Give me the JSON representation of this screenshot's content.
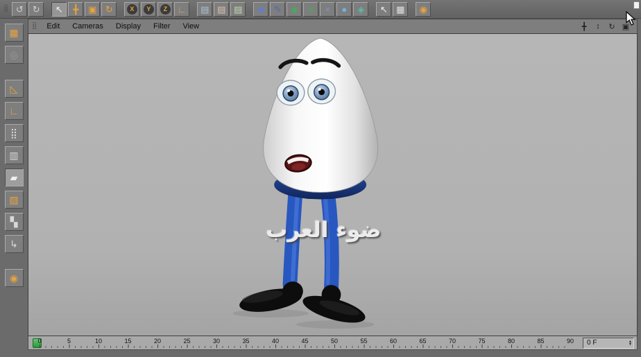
{
  "window": {
    "background": "#6b6b6b",
    "accent": "#e8a33d"
  },
  "top_toolbar": {
    "drag_handle_glyph": "⣿",
    "items": [
      {
        "name": "undo-icon",
        "glyph": "↺",
        "color": "#cfcfcf"
      },
      {
        "name": "redo-icon",
        "glyph": "↻",
        "color": "#cfcfcf"
      },
      {
        "type": "sep"
      },
      {
        "name": "live-selection-tool-icon",
        "glyph": "↖",
        "color": "#f2f2f2",
        "pressed": true
      },
      {
        "name": "move-tool-icon",
        "glyph": "╋",
        "color": "#e8a33d"
      },
      {
        "name": "scale-tool-icon",
        "glyph": "▣",
        "color": "#e8a33d"
      },
      {
        "name": "rotate-tool-icon",
        "glyph": "↻",
        "color": "#e8a33d"
      },
      {
        "type": "sep"
      },
      {
        "name": "lock-x-axis-icon",
        "glyph": "X",
        "cls": "axis"
      },
      {
        "name": "lock-y-axis-icon",
        "glyph": "Y",
        "cls": "axis"
      },
      {
        "name": "lock-z-axis-icon",
        "glyph": "Z",
        "cls": "axis"
      },
      {
        "name": "coordinate-system-icon",
        "glyph": "∟",
        "color": "#e8a33d"
      },
      {
        "type": "sep"
      },
      {
        "name": "render-view-icon",
        "glyph": "▤",
        "color": "#aebfd8"
      },
      {
        "name": "render-picture-viewer-icon",
        "glyph": "▤",
        "color": "#d8c2ae"
      },
      {
        "name": "render-settings-icon",
        "glyph": "▤",
        "color": "#c2d8ae"
      },
      {
        "type": "sep"
      },
      {
        "name": "add-cube-object-icon",
        "glyph": "■",
        "color": "#5b7ed0"
      },
      {
        "name": "add-spline-icon",
        "glyph": "✎",
        "color": "#4a69b8"
      },
      {
        "name": "add-nurbs-icon",
        "glyph": "◆",
        "color": "#49a85c"
      },
      {
        "name": "add-modeling-object-icon",
        "glyph": "∗",
        "color": "#49a85c"
      },
      {
        "name": "add-deformer-icon",
        "glyph": "×",
        "color": "#7e8fd6"
      },
      {
        "name": "add-scene-object-icon",
        "glyph": "●",
        "color": "#6fb3de"
      },
      {
        "name": "add-particle-object-icon",
        "glyph": "◈",
        "color": "#5cb8a8"
      },
      {
        "type": "sep"
      },
      {
        "name": "tool-pointer-icon",
        "glyph": "↖",
        "color": "#efefef"
      },
      {
        "name": "object-manager-icon",
        "glyph": "▦",
        "color": "#e0e0e0"
      },
      {
        "type": "sep"
      },
      {
        "name": "online-updater-globe-icon",
        "glyph": "◉",
        "color": "#e8a33d"
      }
    ]
  },
  "left_toolbar": {
    "items": [
      {
        "name": "make-editable-icon",
        "glyph": "▦",
        "color": "#e8a33d"
      },
      {
        "name": "model-mode-icon",
        "glyph": "◎",
        "color": "#9a9a9a"
      },
      {
        "type": "sep"
      },
      {
        "name": "axis-mode-icon",
        "glyph": "◺",
        "color": "#e8a33d"
      },
      {
        "name": "object-axis-mode-icon",
        "glyph": "∟",
        "color": "#e8a33d"
      },
      {
        "name": "points-mode-icon",
        "glyph": "⣿",
        "color": "#d8d8d8"
      },
      {
        "name": "edges-mode-icon",
        "glyph": "▥",
        "color": "#d8d8d8"
      },
      {
        "name": "polygons-mode-icon",
        "glyph": "▰",
        "color": "#f0f0f0",
        "pressed": true
      },
      {
        "name": "texture-mode-icon",
        "glyph": "▨",
        "color": "#e8a33d"
      },
      {
        "name": "texture-axis-mode-icon",
        "glyph": "▚",
        "color": "#d8d8d8"
      },
      {
        "name": "animation-mode-icon",
        "glyph": "↳",
        "color": "#d8d8d8"
      },
      {
        "type": "sep"
      },
      {
        "name": "snap-settings-icon",
        "glyph": "◉",
        "color": "#e8a33d"
      }
    ]
  },
  "viewport": {
    "drag_handle_glyph": "⣿",
    "menu": [
      {
        "name": "menu-edit",
        "label": "Edit"
      },
      {
        "name": "menu-cameras",
        "label": "Cameras"
      },
      {
        "name": "menu-display",
        "label": "Display"
      },
      {
        "name": "menu-filter",
        "label": "Filter"
      },
      {
        "name": "menu-view",
        "label": "View"
      }
    ],
    "controls": [
      {
        "name": "pan-view-icon",
        "glyph": "╋"
      },
      {
        "name": "zoom-view-icon",
        "glyph": "↕"
      },
      {
        "name": "rotate-view-icon",
        "glyph": "↻"
      },
      {
        "name": "toggle-view-icon",
        "glyph": "▣"
      }
    ],
    "watermark": "ضوء العرب",
    "scene_object": "egg cartoon character with blue legs and black shoes"
  },
  "timeline": {
    "ticks": [
      {
        "label": "0"
      },
      {
        "label": "5"
      },
      {
        "label": "10"
      },
      {
        "label": "15"
      },
      {
        "label": "20"
      },
      {
        "label": "25"
      },
      {
        "label": "30"
      },
      {
        "label": "35"
      },
      {
        "label": "40"
      },
      {
        "label": "45"
      },
      {
        "label": "50"
      },
      {
        "label": "55"
      },
      {
        "label": "60"
      },
      {
        "label": "65"
      },
      {
        "label": "70"
      },
      {
        "label": "75"
      },
      {
        "label": "80"
      },
      {
        "label": "85"
      },
      {
        "label": "90"
      }
    ],
    "current_frame_marker": {
      "frame": 0,
      "color": "#3cae4a"
    },
    "frame_field": {
      "value": "0 F",
      "spinner_up": "▴",
      "spinner_down": "▾"
    }
  }
}
